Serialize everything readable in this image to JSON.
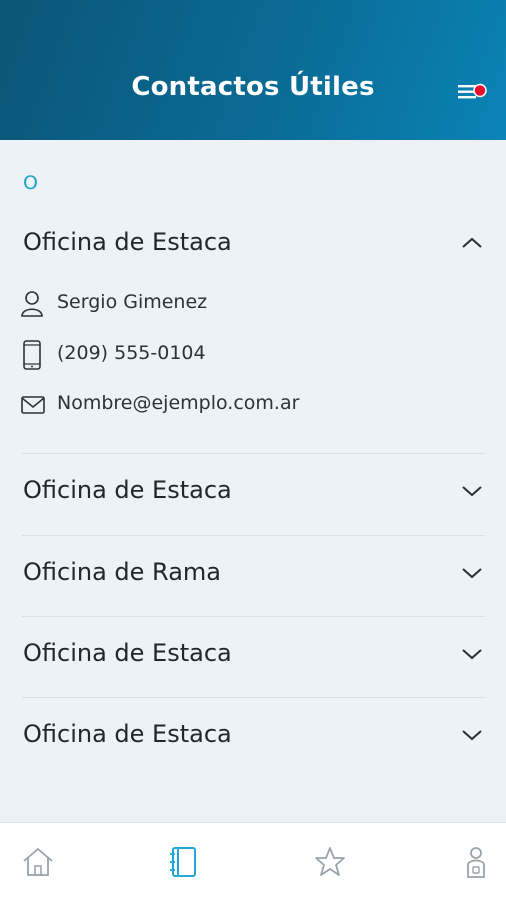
{
  "header": {
    "title": "Contactos Útiles",
    "menu_icon": "menu-notification-icon",
    "notification_color": "#e8112d"
  },
  "section": {
    "letter": "O"
  },
  "expanded": {
    "title": "Oficina de Estaca",
    "contact_name": "Sergio Gimenez",
    "phone": "(209) 555-0104",
    "email": "Nombre@ejemplo.com.ar"
  },
  "collapsed": [
    {
      "title": "Oficina de Estaca"
    },
    {
      "title": "Oficina de Rama"
    },
    {
      "title": "Oficina de Estaca"
    },
    {
      "title": "Oficina de Estaca"
    }
  ],
  "tabbar": {
    "items": [
      "home-icon",
      "contacts-book-icon",
      "star-icon",
      "profile-icon"
    ],
    "active": "contacts-book-icon",
    "active_color": "#20a8d8",
    "inactive_color": "#9aa3aa"
  },
  "colors": {
    "accent": "#1fa4c9",
    "header_start": "#0b5577",
    "header_end": "#0a84b6"
  }
}
